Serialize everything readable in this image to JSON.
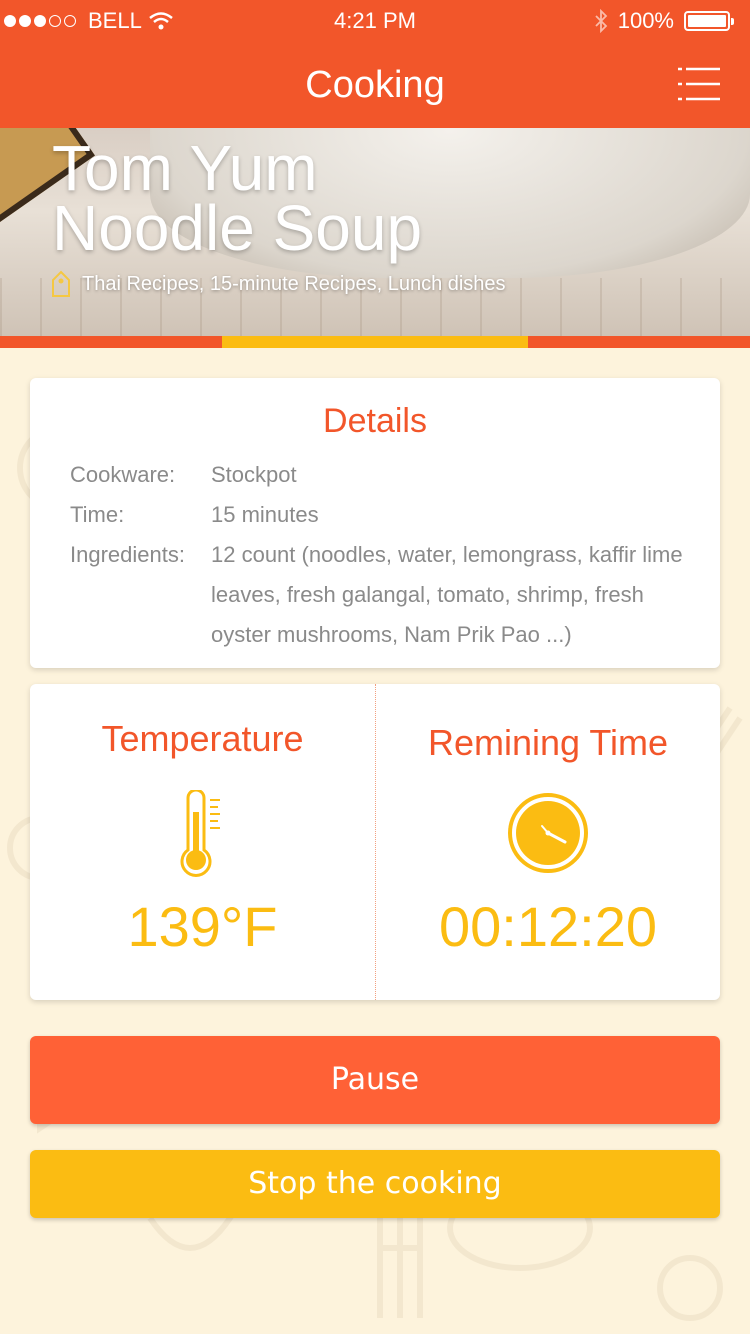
{
  "status_bar": {
    "carrier": "BELL",
    "time": "4:21 PM",
    "battery": "100%",
    "signal_strength": 3,
    "signal_max": 5
  },
  "nav": {
    "title": "Cooking",
    "menu_icon": "hamburger-menu-icon"
  },
  "recipe": {
    "title_line1": "Tom Yum",
    "title_line2": "Noodle Soup",
    "tags": "Thai Recipes, 15-minute Recipes, Lunch dishes",
    "tag_icon": "tag-icon"
  },
  "progress": {
    "segment_start": 0.296,
    "segment_end": 0.704
  },
  "details": {
    "heading": "Details",
    "rows": [
      {
        "key": "Cookware:",
        "value": "Stockpot"
      },
      {
        "key": "Time:",
        "value": "15 minutes"
      },
      {
        "key": "Ingredients:",
        "value": "12 count (noodles, water, lemongrass, kaffir lime leaves,  fresh galangal, tomato, shrimp, fresh oyster mushrooms, Nam Prik Pao ...)"
      }
    ]
  },
  "temperature": {
    "label": "Temperature",
    "value": "139°F",
    "icon": "thermometer-icon"
  },
  "remaining": {
    "label": "Remining Time",
    "value": "00:12:20",
    "icon": "clock-icon"
  },
  "actions": {
    "pause_label": "Pause",
    "stop_label": "Stop the cooking"
  },
  "colors": {
    "primary": "#f2562a",
    "accent": "#fbbc12",
    "background": "#fdf3dc",
    "pause_button": "#ff6136"
  }
}
